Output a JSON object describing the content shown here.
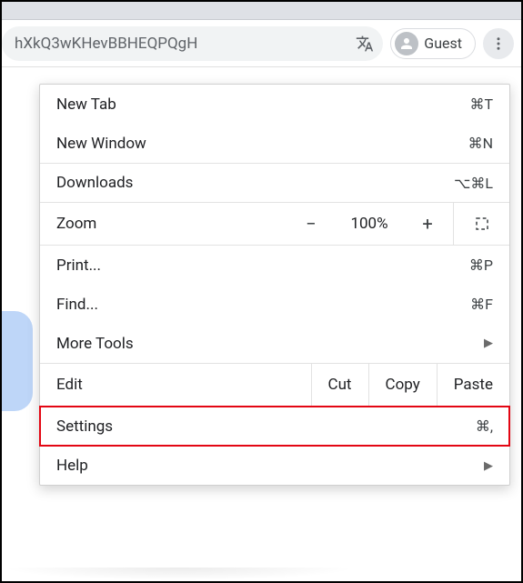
{
  "toolbar": {
    "url_fragment": "hXkQ3wKHevBBHEQPQgH",
    "guest_label": "Guest"
  },
  "menu": {
    "new_tab": {
      "label": "New Tab",
      "shortcut": "⌘T"
    },
    "new_window": {
      "label": "New Window",
      "shortcut": "⌘N"
    },
    "downloads": {
      "label": "Downloads",
      "shortcut": "⌥⌘L"
    },
    "zoom": {
      "label": "Zoom",
      "value": "100%",
      "minus": "−",
      "plus": "+"
    },
    "print": {
      "label": "Print...",
      "shortcut": "⌘P"
    },
    "find": {
      "label": "Find...",
      "shortcut": "⌘F"
    },
    "more_tools": {
      "label": "More Tools"
    },
    "edit": {
      "label": "Edit",
      "cut": "Cut",
      "copy": "Copy",
      "paste": "Paste"
    },
    "settings": {
      "label": "Settings",
      "shortcut": "⌘,"
    },
    "help": {
      "label": "Help"
    }
  }
}
